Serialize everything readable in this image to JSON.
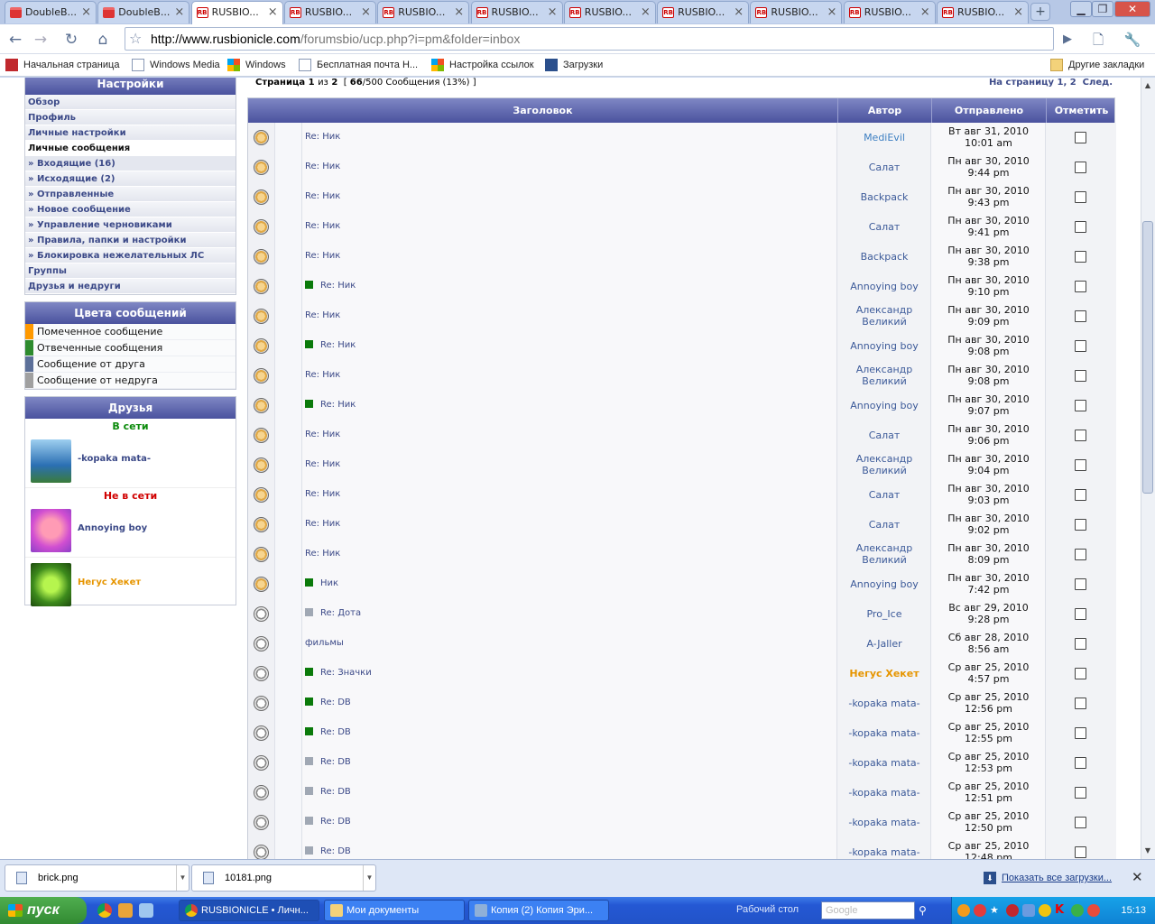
{
  "browser": {
    "tabs": [
      {
        "title": "DoubleB...",
        "fav": "db"
      },
      {
        "title": "DoubleB...",
        "fav": "db"
      },
      {
        "title": "RUSBIO...",
        "fav": "rb",
        "active": true
      },
      {
        "title": "RUSBIO...",
        "fav": "rb"
      },
      {
        "title": "RUSBIO...",
        "fav": "rb"
      },
      {
        "title": "RUSBIO...",
        "fav": "rb"
      },
      {
        "title": "RUSBIO...",
        "fav": "rb"
      },
      {
        "title": "RUSBIO...",
        "fav": "rb"
      },
      {
        "title": "RUSBIO...",
        "fav": "rb"
      },
      {
        "title": "RUSBIO...",
        "fav": "rb"
      },
      {
        "title": "RUSBIO...",
        "fav": "rb"
      }
    ],
    "url_host": "http://www.rusbionicle.com",
    "url_path": "/forumsbio/ucp.php?i=pm&folder=inbox",
    "bookmarks": [
      {
        "label": "Начальная страница",
        "icon": "home-bookmark-icon"
      },
      {
        "label": "Windows Media",
        "icon": "page-icon"
      },
      {
        "label": "Windows",
        "icon": "windows-icon"
      },
      {
        "label": "Бесплатная почта Н...",
        "icon": "page-icon"
      },
      {
        "label": "Настройка ссылок",
        "icon": "windows-icon"
      },
      {
        "label": "Загрузки",
        "icon": "download-icon"
      }
    ],
    "other_bookmarks": "Другие закладки"
  },
  "sidebar": {
    "settings_title": "Настройки",
    "items": [
      "Обзор",
      "Профиль",
      "Личные настройки"
    ],
    "pm_title": "Личные сообщения",
    "pm_items": [
      "Входящие (16)",
      "Исходящие (2)",
      "Отправленные",
      "Новое сообщение",
      "Управление черновиками",
      "Правила, папки и настройки",
      "Блокировка нежелательных ЛС"
    ],
    "bottom_items": [
      "Группы",
      "Друзья и недруги"
    ],
    "colors_title": "Цвета сообщений",
    "colors": [
      {
        "label": "Помеченное сообщение",
        "color": "#ff9900"
      },
      {
        "label": "Отвеченные сообщения",
        "color": "#2e8b2e"
      },
      {
        "label": "Сообщение от друга",
        "color": "#5c7099"
      },
      {
        "label": "Сообщение от недруга",
        "color": "#a0a0a0"
      }
    ],
    "friends_title": "Друзья",
    "online_label": "В сети",
    "offline_label": "Не в сети",
    "online": [
      {
        "name": "-kopaka mata-",
        "color": "#3c4a88"
      }
    ],
    "offline": [
      {
        "name": "Annoying boy",
        "color": "#3c4a88"
      },
      {
        "name": "Негус Хекет",
        "color": "#e69500"
      }
    ]
  },
  "pager": {
    "page_prefix": "Страница",
    "page_current": "1",
    "page_of": "из",
    "page_total": "2",
    "count": "66",
    "count_rest": "/500 Сообщения (13%) ]",
    "count_open": "[",
    "goto_label": "На страницу",
    "goto_pages": "1, 2",
    "next": "След."
  },
  "table": {
    "headers": [
      "Заголовок",
      "Автор",
      "Отправлено",
      "Отметить"
    ],
    "rows": [
      {
        "subject": "Re: Ник",
        "author": "MediEvil",
        "date1": "Вт авг 31, 2010",
        "date2": "10:01 am",
        "mark": "",
        "unread": true,
        "acolor": "#3c5a99"
      },
      {
        "subject": "Re: Ник",
        "author": "Салат",
        "date1": "Пн авг 30, 2010",
        "date2": "9:44 pm",
        "mark": "",
        "unread": true,
        "acolor": "#3c5a99"
      },
      {
        "subject": "Re: Ник",
        "author": "Backpack",
        "date1": "Пн авг 30, 2010",
        "date2": "9:43 pm",
        "mark": "",
        "unread": true,
        "acolor": "#3c5a99"
      },
      {
        "subject": "Re: Ник",
        "author": "Салат",
        "date1": "Пн авг 30, 2010",
        "date2": "9:41 pm",
        "mark": "",
        "unread": true,
        "acolor": "#3c5a99"
      },
      {
        "subject": "Re: Ник",
        "author": "Backpack",
        "date1": "Пн авг 30, 2010",
        "date2": "9:38 pm",
        "mark": "",
        "unread": true,
        "acolor": "#3c5a99"
      },
      {
        "subject": "Re: Ник",
        "author": "Annoying boy",
        "date1": "Пн авг 30, 2010",
        "date2": "9:10 pm",
        "mark": "#0a7a0a",
        "unread": true,
        "acolor": "#3c5a99"
      },
      {
        "subject": "Re: Ник",
        "author": "Александр Великий",
        "date1": "Пн авг 30, 2010",
        "date2": "9:09 pm",
        "mark": "",
        "unread": true,
        "acolor": "#3c5a99"
      },
      {
        "subject": "Re: Ник",
        "author": "Annoying boy",
        "date1": "Пн авг 30, 2010",
        "date2": "9:08 pm",
        "mark": "#0a7a0a",
        "unread": true,
        "acolor": "#3c5a99"
      },
      {
        "subject": "Re: Ник",
        "author": "Александр Великий",
        "date1": "Пн авг 30, 2010",
        "date2": "9:08 pm",
        "mark": "",
        "unread": true,
        "acolor": "#3c5a99"
      },
      {
        "subject": "Re: Ник",
        "author": "Annoying boy",
        "date1": "Пн авг 30, 2010",
        "date2": "9:07 pm",
        "mark": "#0a7a0a",
        "unread": true,
        "acolor": "#3c5a99"
      },
      {
        "subject": "Re: Ник",
        "author": "Салат",
        "date1": "Пн авг 30, 2010",
        "date2": "9:06 pm",
        "mark": "",
        "unread": true,
        "acolor": "#3c5a99"
      },
      {
        "subject": "Re: Ник",
        "author": "Александр Великий",
        "date1": "Пн авг 30, 2010",
        "date2": "9:04 pm",
        "mark": "",
        "unread": true,
        "acolor": "#3c5a99"
      },
      {
        "subject": "Re: Ник",
        "author": "Салат",
        "date1": "Пн авг 30, 2010",
        "date2": "9:03 pm",
        "mark": "",
        "unread": true,
        "acolor": "#3c5a99"
      },
      {
        "subject": "Re: Ник",
        "author": "Салат",
        "date1": "Пн авг 30, 2010",
        "date2": "9:02 pm",
        "mark": "",
        "unread": true,
        "acolor": "#3c5a99"
      },
      {
        "subject": "Re: Ник",
        "author": "Александр Великий",
        "date1": "Пн авг 30, 2010",
        "date2": "8:09 pm",
        "mark": "",
        "unread": true,
        "acolor": "#3c5a99"
      },
      {
        "subject": "Ник",
        "author": "Annoying boy",
        "date1": "Пн авг 30, 2010",
        "date2": "7:42 pm",
        "mark": "#0a7a0a",
        "unread": true,
        "acolor": "#3c5a99"
      },
      {
        "subject": "Re: Дота",
        "author": "Pro_Ice",
        "date1": "Вс авг 29, 2010",
        "date2": "9:28 pm",
        "mark": "#a0a8b4",
        "unread": false,
        "acolor": "#3c5a99"
      },
      {
        "subject": "фильмы",
        "author": "A-Jaller",
        "date1": "Сб авг 28, 2010",
        "date2": "8:56 am",
        "mark": "",
        "unread": false,
        "acolor": "#3c5a99"
      },
      {
        "subject": "Re: Значки",
        "author": "Негус Хекет",
        "date1": "Ср авг 25, 2010",
        "date2": "4:57 pm",
        "mark": "#0a7a0a",
        "unread": false,
        "acolor": "#e69500"
      },
      {
        "subject": "Re: DB",
        "author": "-kopaka mata-",
        "date1": "Ср авг 25, 2010",
        "date2": "12:56 pm",
        "mark": "#0a7a0a",
        "unread": false,
        "acolor": "#3c5a99"
      },
      {
        "subject": "Re: DB",
        "author": "-kopaka mata-",
        "date1": "Ср авг 25, 2010",
        "date2": "12:55 pm",
        "mark": "#0a7a0a",
        "unread": false,
        "acolor": "#3c5a99"
      },
      {
        "subject": "Re: DB",
        "author": "-kopaka mata-",
        "date1": "Ср авг 25, 2010",
        "date2": "12:53 pm",
        "mark": "#a0a8b4",
        "unread": false,
        "acolor": "#3c5a99"
      },
      {
        "subject": "Re: DB",
        "author": "-kopaka mata-",
        "date1": "Ср авг 25, 2010",
        "date2": "12:51 pm",
        "mark": "#a0a8b4",
        "unread": false,
        "acolor": "#3c5a99"
      },
      {
        "subject": "Re: DB",
        "author": "-kopaka mata-",
        "date1": "Ср авг 25, 2010",
        "date2": "12:50 pm",
        "mark": "#a0a8b4",
        "unread": false,
        "acolor": "#3c5a99"
      },
      {
        "subject": "Re: DB",
        "author": "-kopaka mata-",
        "date1": "Ср авг 25, 2010",
        "date2": "12:48 pm",
        "mark": "#a0a8b4",
        "unread": false,
        "acolor": "#3c5a99"
      }
    ]
  },
  "downloads": {
    "items": [
      "brick.png",
      "10181.png"
    ],
    "show_all": "Показать все загрузки..."
  },
  "taskbar": {
    "start": "пуск",
    "windows": [
      "RUSBIONICLE • Личн...",
      "Мои документы",
      "Копия (2) Копия Эри..."
    ],
    "desktop_label": "Рабочий стол",
    "search_placeholder": "Google",
    "clock": "15:13"
  }
}
